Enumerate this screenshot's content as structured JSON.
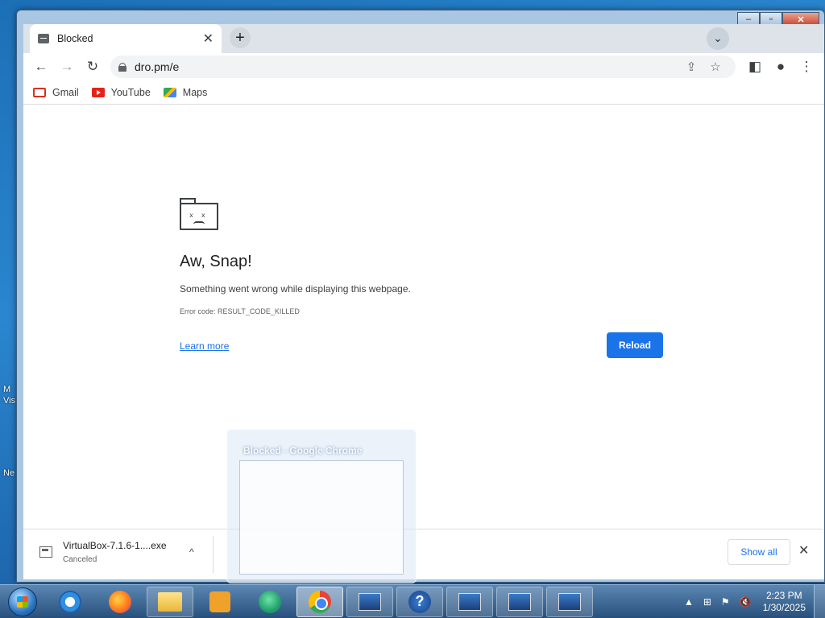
{
  "desktop": {
    "labels": [
      "M",
      "Vis",
      "Ne"
    ]
  },
  "window": {
    "min_label": "–",
    "max_label": "▫",
    "close_label": "✕"
  },
  "tab": {
    "title": "Blocked",
    "close": "✕"
  },
  "newtab_label": "+",
  "tabsearch_label": "⌄",
  "toolbar": {
    "back": "←",
    "forward": "→",
    "reload": "↻",
    "url": "dro.pm/e",
    "share": "⇪",
    "star": "☆",
    "sidepanel": "◧",
    "profile": "●",
    "menu": "⋮"
  },
  "bookmarks": [
    {
      "label": "Gmail",
      "icon": "gmail-icon"
    },
    {
      "label": "YouTube",
      "icon": "youtube-icon"
    },
    {
      "label": "Maps",
      "icon": "maps-icon"
    }
  ],
  "error_page": {
    "heading": "Aw, Snap!",
    "message": "Something went wrong while displaying this webpage.",
    "error_code": "Error code: RESULT_CODE_KILLED",
    "learn_more": "Learn more",
    "reload_button": "Reload",
    "icon": "sad-tab-icon"
  },
  "download": {
    "filename": "VirtualBox-7.1.6-1....exe",
    "status": "Canceled",
    "chevron": "^",
    "show_all": "Show all",
    "close": "✕"
  },
  "preview": {
    "title": "Blocked - Google Chrome"
  },
  "taskbar": {
    "help_label": "?",
    "tray_up": "▲",
    "time": "2:23 PM",
    "date": "1/30/2025"
  }
}
